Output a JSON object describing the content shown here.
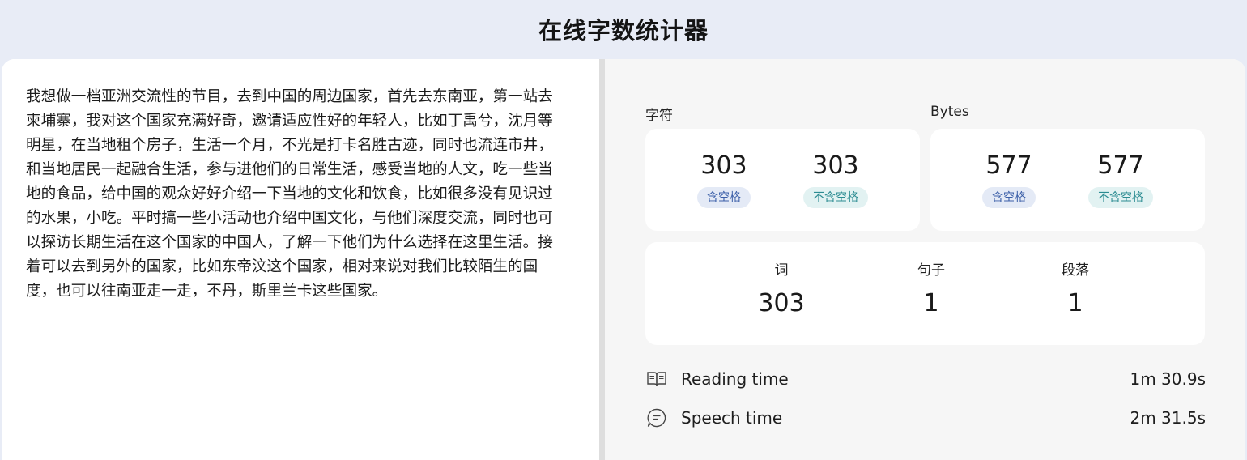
{
  "header": {
    "title": "在线字数统计器"
  },
  "editor": {
    "text": "我想做一档亚洲交流性的节目，去到中国的周边国家，首先去东南亚，第一站去柬埔寨，我对这个国家充满好奇，邀请适应性好的年轻人，比如丁禹兮，沈月等明星，在当地租个房子，生活一个月，不光是打卡名胜古迹，同时也流连市井，和当地居民一起融合生活，参与进他们的日常生活，感受当地的人文，吃一些当地的食品，给中国的观众好好介绍一下当地的文化和饮食，比如很多没有见识过的水果，小吃。平时搞一些小活动也介绍中国文化，与他们深度交流，同时也可以探访长期生活在这个国家的中国人，了解一下他们为什么选择在这里生活。接着可以去到另外的国家，比如东帝汶这个国家，相对来说对我们比较陌生的国度，也可以往南亚走一走，不丹，斯里兰卡这些国家。"
  },
  "characters": {
    "label": "字符",
    "with_spaces": {
      "value": "303",
      "tag": "含空格"
    },
    "without_spaces": {
      "value": "303",
      "tag": "不含空格"
    }
  },
  "bytes": {
    "label": "Bytes",
    "with_spaces": {
      "value": "577",
      "tag": "含空格"
    },
    "without_spaces": {
      "value": "577",
      "tag": "不含空格"
    }
  },
  "counts": {
    "words": {
      "label": "词",
      "value": "303"
    },
    "sentences": {
      "label": "句子",
      "value": "1"
    },
    "paragraphs": {
      "label": "段落",
      "value": "1"
    }
  },
  "reading": {
    "label": "Reading time",
    "value": "1m 30.9s",
    "icon": "book-icon"
  },
  "speech": {
    "label": "Speech time",
    "value": "2m 31.5s",
    "icon": "speech-bubble-icon"
  }
}
